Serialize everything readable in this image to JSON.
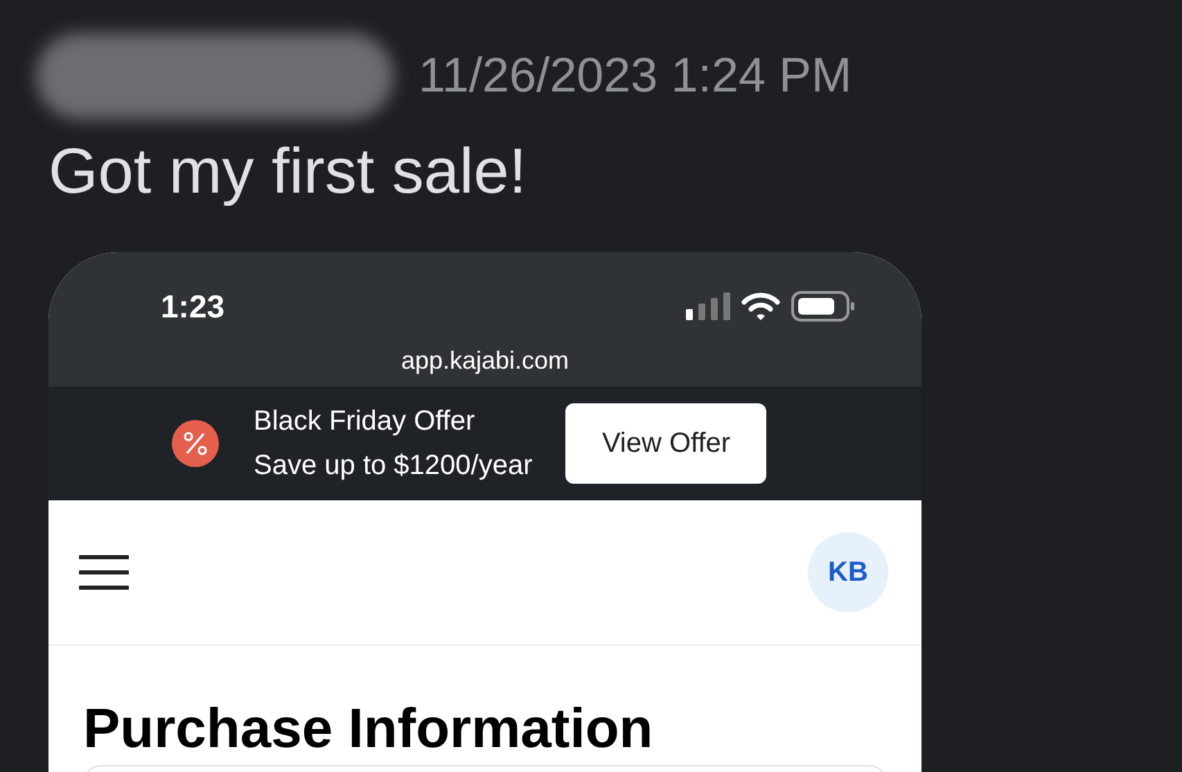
{
  "message": {
    "timestamp": "11/26/2023 1:24 PM",
    "text": "Got my first sale!"
  },
  "phone": {
    "status_time": "1:23",
    "url": "app.kajabi.com",
    "banner": {
      "title": "Black Friday Offer",
      "subtitle": "Save up to $1200/year",
      "button": "View Offer"
    },
    "avatar_initials": "KB",
    "page_title": "Purchase Information"
  }
}
